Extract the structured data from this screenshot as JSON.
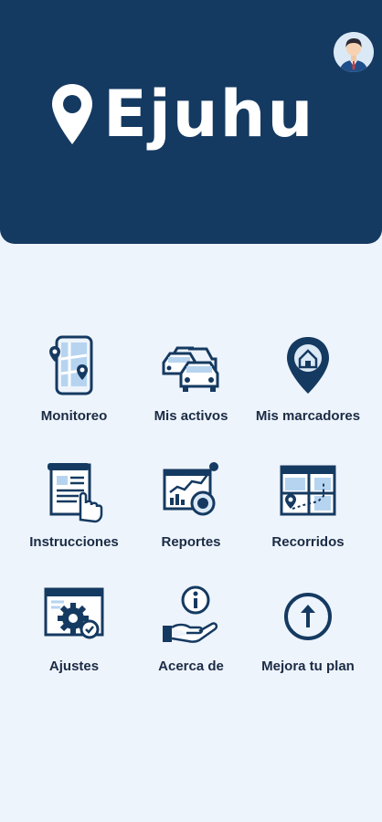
{
  "header": {
    "app_name": "Ejuhu",
    "avatar_icon": "user-avatar-icon",
    "background_color": "#153a61"
  },
  "menu": {
    "items": [
      {
        "label": "Monitoreo",
        "icon": "phone-map-icon"
      },
      {
        "label": "Mis activos",
        "icon": "cars-icon"
      },
      {
        "label": "Mis marcadores",
        "icon": "location-pin-home-icon"
      },
      {
        "label": "Instrucciones",
        "icon": "document-hand-icon"
      },
      {
        "label": "Reportes",
        "icon": "report-chart-icon"
      },
      {
        "label": "Recorridos",
        "icon": "route-map-icon"
      },
      {
        "label": "Ajustes",
        "icon": "gear-window-icon"
      },
      {
        "label": "Acerca de",
        "icon": "info-hand-icon"
      },
      {
        "label": "Mejora tu plan",
        "icon": "arrow-up-circle-icon"
      }
    ]
  },
  "colors": {
    "primary": "#153a61",
    "background": "#eef4fc",
    "text": "#1a2b44"
  }
}
